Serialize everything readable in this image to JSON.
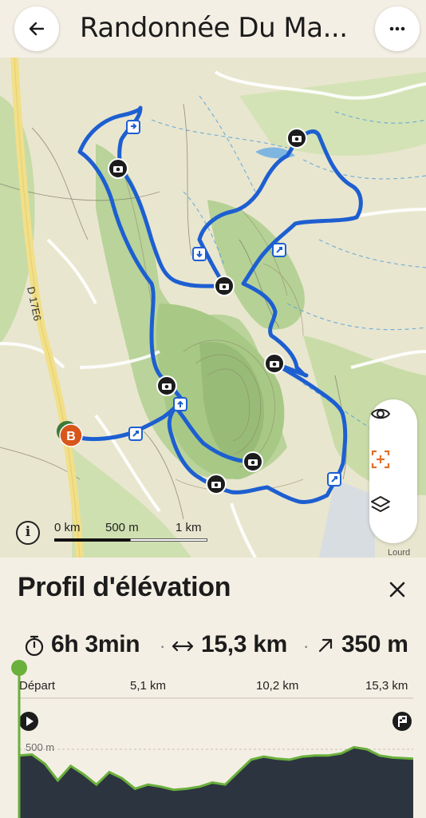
{
  "header": {
    "title": "Randonnée Du Ma...",
    "back_icon": "arrow-left-icon",
    "menu_icon": "more-horizontal-icon"
  },
  "map": {
    "road_label": "D 17E6",
    "start_marker": "B",
    "scale": {
      "zero": "0 km",
      "mid": "500 m",
      "end": "1 km"
    },
    "attribution": "Lourd",
    "route_color": "#1d5fd1",
    "controls": [
      "eye-icon",
      "recenter-icon",
      "layers-icon"
    ]
  },
  "panel": {
    "title": "Profil d'élévation",
    "stats": {
      "duration": "6h 3min",
      "distance": "15,3 km",
      "elevation_gain": "350 m"
    },
    "chart_data": {
      "type": "area",
      "x_ticks": [
        "Départ",
        "5,1 km",
        "10,2 km",
        "15,3 km"
      ],
      "y_ticks": [
        "500 m"
      ],
      "x": [
        0,
        0.5,
        1.0,
        1.5,
        2.0,
        2.5,
        3.0,
        3.5,
        4.0,
        4.5,
        5.0,
        5.5,
        6.0,
        6.5,
        7.0,
        7.5,
        8.0,
        8.5,
        9.0,
        9.5,
        10.0,
        10.5,
        11.0,
        11.5,
        12.0,
        12.5,
        13.0,
        13.5,
        14.0,
        14.5,
        15.3
      ],
      "elevation_m": [
        470,
        475,
        430,
        350,
        420,
        380,
        330,
        390,
        360,
        310,
        330,
        320,
        305,
        310,
        320,
        340,
        330,
        390,
        450,
        465,
        455,
        450,
        465,
        470,
        470,
        480,
        510,
        500,
        470,
        460,
        455
      ]
    }
  }
}
